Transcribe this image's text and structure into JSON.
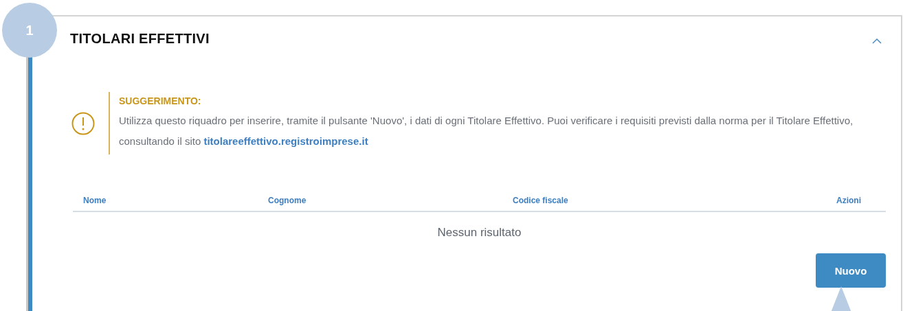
{
  "step": {
    "number": "1"
  },
  "section": {
    "title": "TITOLARI EFFETTIVI",
    "expanded": true
  },
  "tip": {
    "heading": "SUGGERIMENTO:",
    "text": "Utilizza questo riquadro per inserire, tramite il pulsante 'Nuovo', i dati di ogni Titolare Effettivo. Puoi verificare i requisiti previsti dalla norma per il Titolare Effettivo, consultando il sito",
    "link": "titolareeffettivo.registroimprese.it"
  },
  "table": {
    "columns": [
      "Nome",
      "Cognome",
      "Codice fiscale",
      "Azioni"
    ],
    "empty_message": "Nessun risultato"
  },
  "buttons": [
    {
      "label": "Nuovo"
    }
  ]
}
